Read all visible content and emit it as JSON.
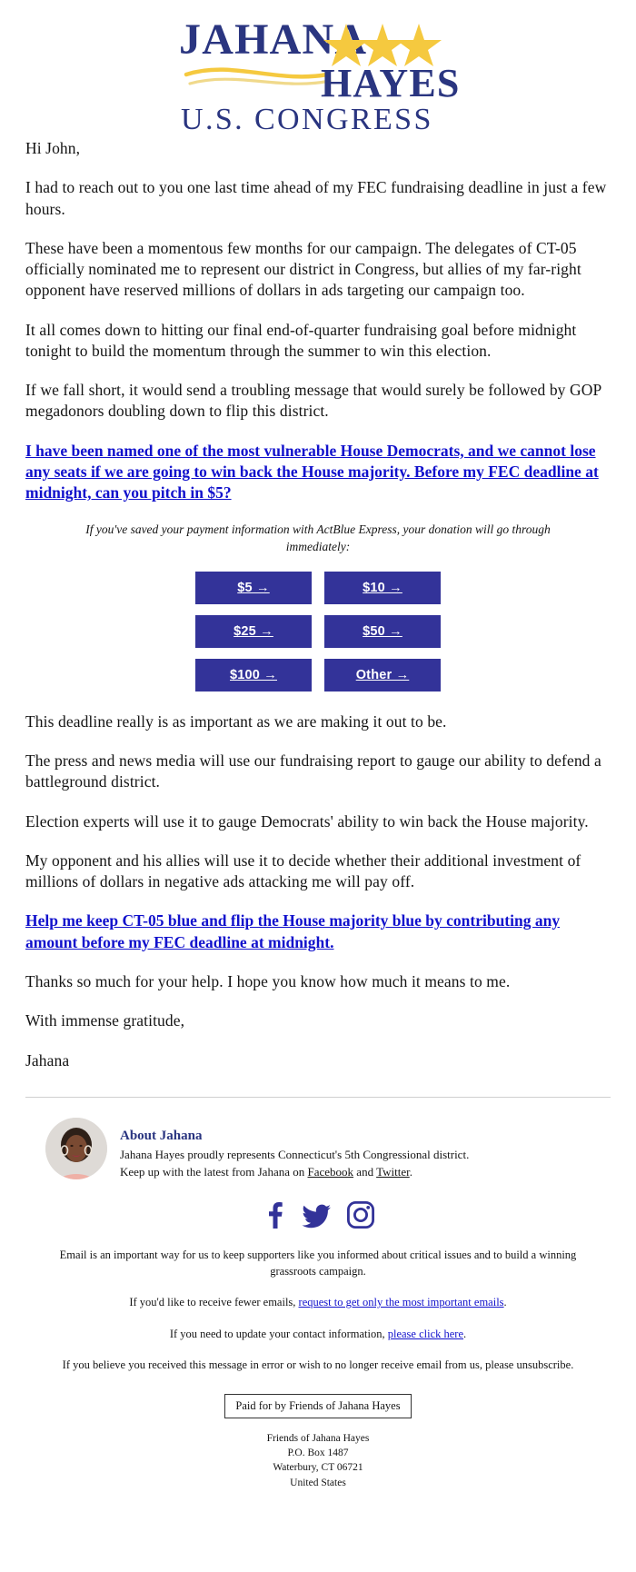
{
  "logo": {
    "line1": "JAHANA",
    "line2": "HAYES",
    "line3": "U.S. CONGRESS",
    "star_count": 3,
    "navy": "#2a3580",
    "gold": "#f5c93f"
  },
  "letter": {
    "greeting": "Hi John,",
    "paragraphs": [
      "I had to reach out to you one last time ahead of my FEC fundraising deadline in just a few hours.",
      "These have been a momentous few months for our campaign. The delegates of CT-05 officially nominated me to represent our district in Congress, but allies of my far-right opponent have reserved millions of dollars in ads targeting our campaign too.",
      "It all comes down to hitting our final end-of-quarter fundraising goal before midnight tonight to build the momentum through the summer to win this election.",
      "If we fall short, it would send a troubling message that would surely be followed by GOP megadonors doubling down to flip this district."
    ],
    "primary_link": "I have been named one of the most vulnerable House Democrats, and we cannot lose any seats if we are going to win back the House majority. Before my FEC deadline at midnight, can you pitch in $5?",
    "actblue_note": "If you've saved your payment information with ActBlue Express, your donation will go through immediately:",
    "paragraphs_after": [
      "This deadline really is as important as we are making it out to be.",
      "The press and news media will use our fundraising report to gauge our ability to defend a battleground district.",
      "Election experts will use it to gauge Democrats' ability to win back the House majority.",
      "My opponent and his allies will use it to decide whether their additional investment of millions of dollars in negative ads attacking me will pay off."
    ],
    "secondary_link": "Help me keep CT-05 blue and flip the House majority blue by contributing any amount before my FEC deadline at midnight.",
    "closing_paragraph": "Thanks so much for your help. I hope you know how much it means to me.",
    "signoff": "With immense gratitude,",
    "signature": "Jahana"
  },
  "donate": {
    "button_color": "#333399",
    "buttons": [
      {
        "label": "$5 →",
        "amount": "5"
      },
      {
        "label": "$10 →",
        "amount": "10"
      },
      {
        "label": "$25 →",
        "amount": "25"
      },
      {
        "label": "$50 →",
        "amount": "50"
      },
      {
        "label": "$100 →",
        "amount": "100"
      },
      {
        "label": "Other →",
        "amount": "other"
      }
    ]
  },
  "about": {
    "title": "About Jahana",
    "line1_pre": "Jahana Hayes proudly represents Connecticut's 5th Congressional district.",
    "line2_pre": "Keep up with the latest from Jahana on ",
    "facebook": "Facebook",
    "and": " and ",
    "twitter": "Twitter",
    "period": "."
  },
  "social": {
    "icons": [
      "facebook-icon",
      "twitter-icon",
      "instagram-icon"
    ],
    "color": "#333399"
  },
  "footer": {
    "intro": "Email is an important way for us to keep supporters like you informed about critical issues and to build a winning grassroots campaign.",
    "fewer_pre": "If you'd like to receive fewer emails, ",
    "fewer_link": "request to get only the most important emails",
    "fewer_post": ".",
    "contact_pre": "If you need to update your contact information, ",
    "contact_link": "please click here",
    "contact_post": ".",
    "unsub_text": "If you believe you received this message in error or wish to no longer receive email from us, please unsubscribe.",
    "paid_for": "Paid for by Friends of Jahana Hayes",
    "address": {
      "org": "Friends of Jahana Hayes",
      "po_box": "P.O. Box 1487",
      "city_state_zip": "Waterbury, CT 06721",
      "country": "United States"
    }
  }
}
